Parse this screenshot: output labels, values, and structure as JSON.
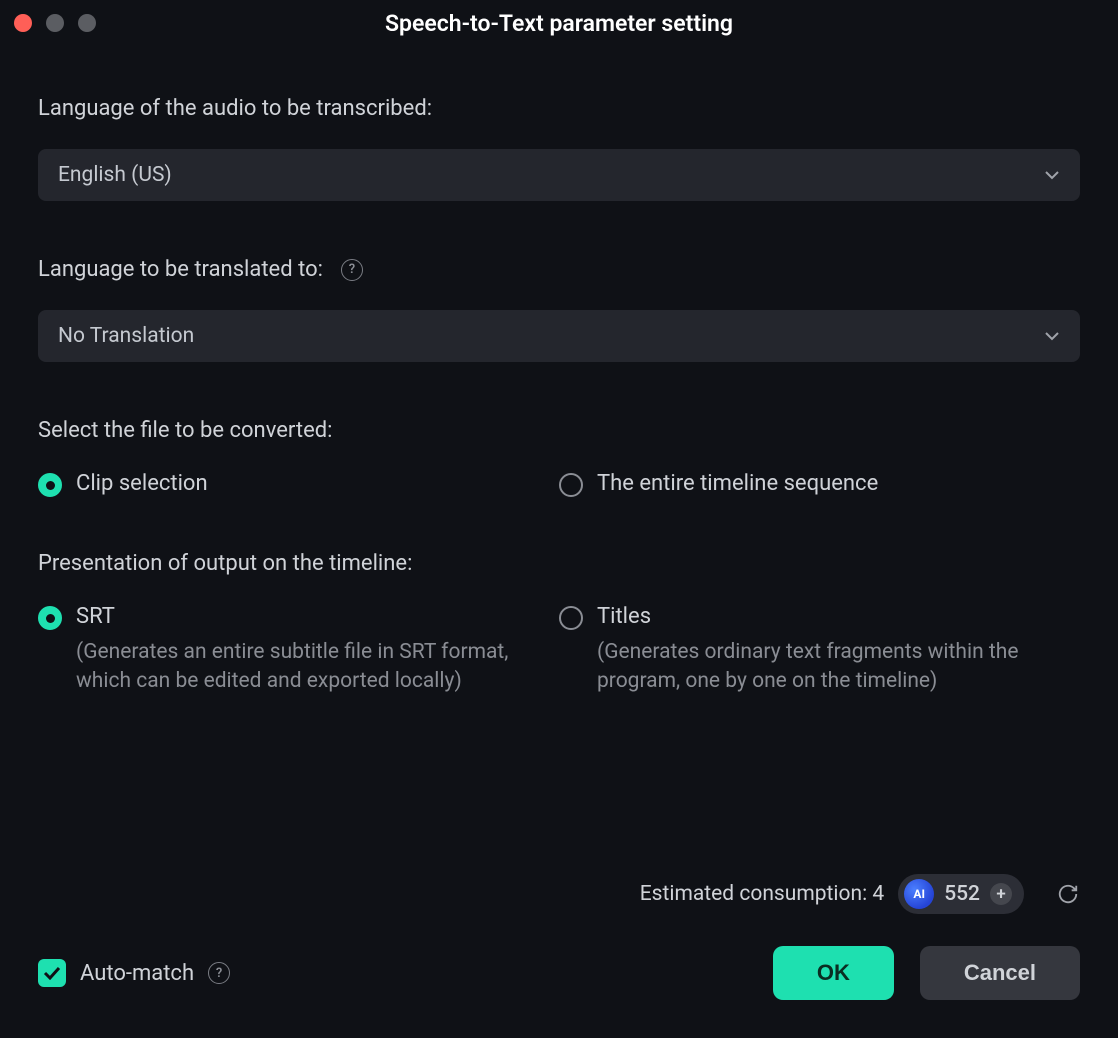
{
  "window": {
    "title": "Speech-to-Text parameter setting"
  },
  "fields": {
    "audio_language_label": "Language of the audio to be transcribed:",
    "audio_language_value": "English (US)",
    "translate_label": "Language to be translated to:",
    "translate_value": "No Translation",
    "file_select_label": "Select the file to be converted:",
    "output_label": "Presentation of output on the timeline:"
  },
  "file_options": {
    "clip": "Clip selection",
    "timeline": "The entire timeline sequence"
  },
  "output_options": {
    "srt_label": "SRT",
    "srt_desc": "(Generates an entire subtitle file in SRT format, which can be edited and exported locally)",
    "titles_label": "Titles",
    "titles_desc": "(Generates ordinary text fragments within the program, one by one on the timeline)"
  },
  "footer": {
    "consumption_label": "Estimated consumption: 4",
    "ai_count": "552",
    "automatch_label": "Auto-match",
    "ok_label": "OK",
    "cancel_label": "Cancel"
  }
}
